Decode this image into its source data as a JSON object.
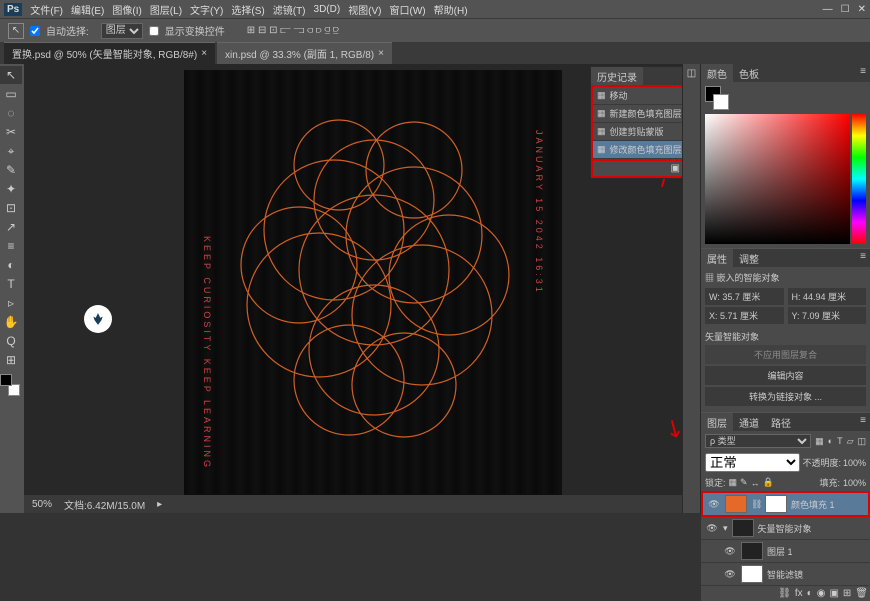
{
  "app": {
    "icon": "Ps"
  },
  "menu": [
    "文件(F)",
    "编辑(E)",
    "图像(I)",
    "图层(L)",
    "文字(Y)",
    "选择(S)",
    "滤镜(T)",
    "3D(D)",
    "视图(V)",
    "窗口(W)",
    "帮助(H)"
  ],
  "optbar": {
    "auto_select": "自动选择:",
    "auto_select_val": "图层",
    "show_transform": "显示变换控件",
    "align_icons": [
      "⫍",
      "⫎",
      "⫏",
      "⫐",
      "⫑",
      "⫒"
    ]
  },
  "tabs": [
    {
      "label": "置换.psd @ 50% (矢量智能对象, RGB/8#)",
      "active": true
    },
    {
      "label": "xin.psd @ 33.3% (副面 1, RGB/8)",
      "active": false
    }
  ],
  "tools": [
    "↖",
    "▭",
    "◌",
    "✂",
    "⌖",
    "✎",
    "✦",
    "⊡",
    "↗",
    "≡",
    "◐",
    "T",
    "▹",
    "✋",
    "Q",
    "⊞"
  ],
  "canvas": {
    "vtext_right": "JANUARY 15 2042 16:31",
    "vtext_left": "KEEP CURIOSITY KEEP LEARNING"
  },
  "status": {
    "zoom": "50%",
    "docinfo": "文档:6.42M/15.0M"
  },
  "history": {
    "title": "历史记录",
    "items": [
      "移动",
      "新建颜色填充图层",
      "创建剪贴蒙版",
      "修改颜色填充图层"
    ],
    "active_idx": 3
  },
  "color_panel": {
    "tab1": "颜色",
    "tab2": "色板"
  },
  "props": {
    "tab1": "属性",
    "tab2": "调整",
    "type": "嵌入的智能对象",
    "w": "W: 35.7 厘米",
    "h": "H: 44.94 厘米",
    "x": "X: 5.71 厘米",
    "y": "Y: 7.09 厘米",
    "vso": "矢量智能对象",
    "noprofile": "不应用图层复合",
    "edit_btn": "编辑内容",
    "convert_btn": "转换为链接对象 ..."
  },
  "layers": {
    "tab1": "图层",
    "tab2": "通道",
    "tab3": "路径",
    "kind": "ρ 类型",
    "blend": "正常",
    "opacity_lbl": "不透明度:",
    "opacity": "100%",
    "lock_lbl": "锁定:",
    "fill_lbl": "填充:",
    "fill": "100%",
    "items": [
      {
        "name": "颜色填充 1",
        "thumb": "orange",
        "mask": true,
        "sel": true,
        "eye": true,
        "link": true
      },
      {
        "name": "矢量智能对象",
        "thumb": "dark",
        "sel": false,
        "eye": true,
        "expand": true
      },
      {
        "name": "图层 1",
        "thumb": "dark",
        "sel": false,
        "eye": true,
        "indent": 1
      },
      {
        "name": "智能滤镜",
        "thumb": "white",
        "sel": false,
        "eye": true,
        "indent": 1
      }
    ]
  }
}
